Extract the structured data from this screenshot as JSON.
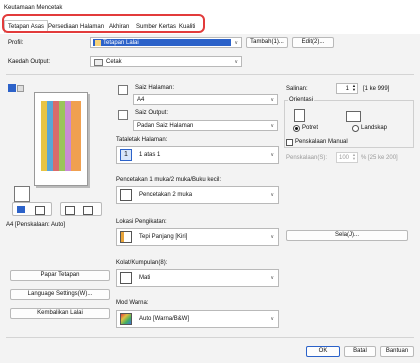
{
  "window": {
    "title": "Keutamaan Mencetak"
  },
  "tabs": [
    {
      "label": "Tetapan Asas"
    },
    {
      "label": "Persediaan Halaman"
    },
    {
      "label": "Akhiran"
    },
    {
      "label": "Sumber Kertas"
    },
    {
      "label": "Kualiti"
    }
  ],
  "profile": {
    "label": "Profil:",
    "value": "Tetapan Lalai",
    "add_label": "Tambah(1)...",
    "edit_label": "Edit(2)..."
  },
  "output": {
    "label": "Kaedah Output:",
    "value": "Cetak"
  },
  "preview": {
    "caption": "A4 [Penskalaan: Auto]"
  },
  "page_size": {
    "label": "Saiz Halaman:",
    "value": "A4"
  },
  "output_size": {
    "label": "Saiz Output:",
    "value": "Padan Saiz Halaman"
  },
  "layout": {
    "label": "Tataletak Halaman:",
    "value": "1 atas 1"
  },
  "duplex": {
    "label": "Pencetakan 1 muka/2 muka/Buku kecil:",
    "value": "Pencetakan 2 muka"
  },
  "binding": {
    "label": "Lokasi Pengikatan:",
    "value": "Tepi Panjang [Kiri]"
  },
  "collate": {
    "label": "Kolat/Kumpulan(8):",
    "value": "Mati"
  },
  "color_mode": {
    "label": "Mod Warna:",
    "value": "Auto [Warna/B&W]"
  },
  "copies": {
    "label": "Salinan:",
    "value": "1",
    "range": "[1 ke 999]"
  },
  "orientation": {
    "label": "Orientasi",
    "portrait": "Potret",
    "landscape": "Landskap"
  },
  "scaling": {
    "checkbox_label": "Penskalaan Manual",
    "label": "Penskalaan(S):",
    "value": "100",
    "range": "% [25 ke 200]"
  },
  "binding_button": "Sela(J)...",
  "left_buttons": {
    "page_settings": "Papar Tetapan",
    "language": "Language Settings(W)...",
    "restore": "Kembalikan Lalai"
  },
  "footer": {
    "ok": "OK",
    "cancel": "Batal",
    "help": "Bantuan"
  }
}
